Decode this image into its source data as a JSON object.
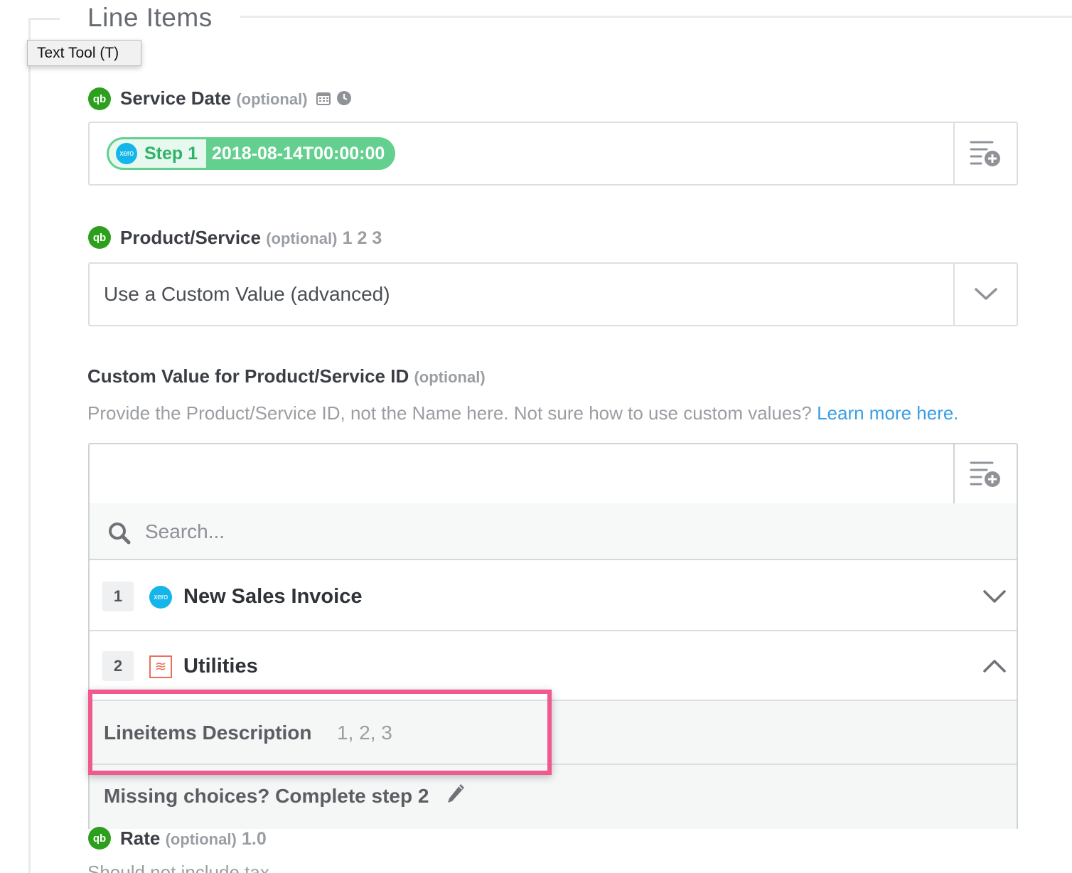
{
  "section": {
    "title": "Line Items"
  },
  "tooltip": {
    "text": "Text Tool (T)"
  },
  "service_date": {
    "label": "Service Date",
    "optional": "(optional)",
    "icons": [
      "calendar-icon",
      "clock-icon"
    ],
    "pill": {
      "step": "Step 1",
      "value": "2018-08-14T00:00:00",
      "app_icon": "xero"
    }
  },
  "product_service": {
    "label": "Product/Service",
    "optional": "(optional)",
    "example": "1 2 3",
    "selected": "Use a Custom Value (advanced)"
  },
  "custom_value": {
    "label": "Custom Value for Product/Service ID",
    "optional": "(optional)",
    "help": "Provide the Product/Service ID, not the Name here. Not sure how to use custom values?",
    "help_link": "Learn more here."
  },
  "dropdown": {
    "search_placeholder": "Search...",
    "steps": [
      {
        "number": "1",
        "title": "New Sales Invoice",
        "app_icon": "xero",
        "expanded": false
      },
      {
        "number": "2",
        "title": "Utilities",
        "app_icon": "formatter",
        "expanded": true
      }
    ],
    "option": {
      "label": "Lineitems Description",
      "values": "1, 2, 3"
    },
    "missing": "Missing choices? Complete step 2"
  },
  "rate": {
    "label": "Rate",
    "optional": "(optional)",
    "example": "1.0",
    "description": "Should not include tax"
  },
  "colors": {
    "quickbooks_green": "#2ca01c",
    "xero_blue": "#13b5ea",
    "pill_green": "#64d08f",
    "link_blue": "#3a9ee4",
    "highlight_pink": "#f0598f"
  }
}
